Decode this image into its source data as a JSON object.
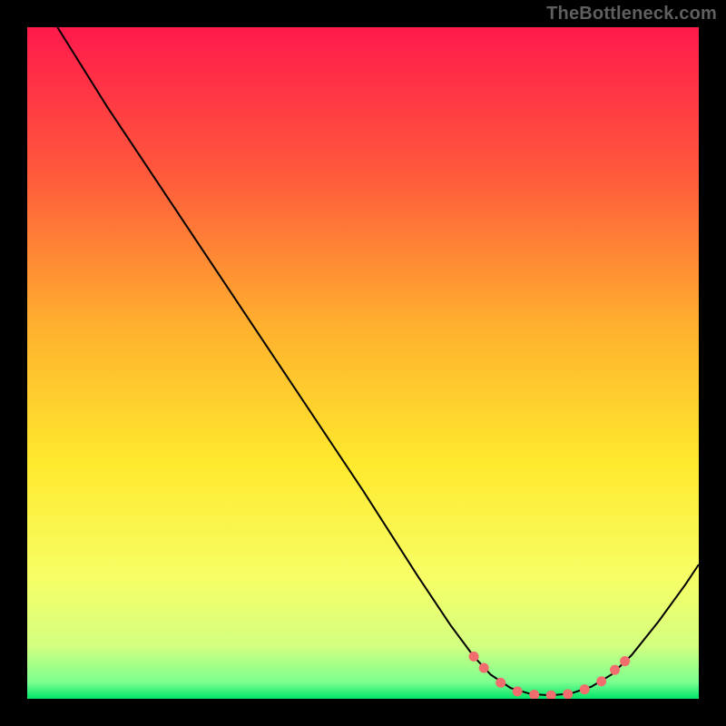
{
  "watermark": "TheBottleneck.com",
  "chart_data": {
    "type": "line",
    "title": "",
    "xlabel": "",
    "ylabel": "",
    "xlim": [
      0,
      100
    ],
    "ylim": [
      0,
      100
    ],
    "grid": false,
    "legend": false,
    "gradient_stops": [
      {
        "pos": 0.0,
        "color": "#ff1a4b"
      },
      {
        "pos": 0.22,
        "color": "#ff5a3c"
      },
      {
        "pos": 0.45,
        "color": "#ffb22e"
      },
      {
        "pos": 0.65,
        "color": "#ffe92e"
      },
      {
        "pos": 0.82,
        "color": "#f7ff66"
      },
      {
        "pos": 0.92,
        "color": "#d4ff80"
      },
      {
        "pos": 0.975,
        "color": "#7cff8f"
      },
      {
        "pos": 1.0,
        "color": "#00e56a"
      }
    ],
    "series": [
      {
        "name": "curve",
        "stroke": "#000000",
        "points": [
          {
            "x": 4.5,
            "y": 100.0
          },
          {
            "x": 7.0,
            "y": 96.0
          },
          {
            "x": 12.0,
            "y": 88.0
          },
          {
            "x": 20.0,
            "y": 76.0
          },
          {
            "x": 30.0,
            "y": 61.0
          },
          {
            "x": 40.0,
            "y": 46.0
          },
          {
            "x": 50.0,
            "y": 31.0
          },
          {
            "x": 58.0,
            "y": 18.5
          },
          {
            "x": 63.0,
            "y": 11.0
          },
          {
            "x": 66.5,
            "y": 6.3
          },
          {
            "x": 69.0,
            "y": 3.6
          },
          {
            "x": 72.0,
            "y": 1.6
          },
          {
            "x": 75.0,
            "y": 0.7
          },
          {
            "x": 78.0,
            "y": 0.5
          },
          {
            "x": 81.0,
            "y": 0.8
          },
          {
            "x": 84.0,
            "y": 1.8
          },
          {
            "x": 87.0,
            "y": 3.6
          },
          {
            "x": 90.0,
            "y": 6.5
          },
          {
            "x": 94.0,
            "y": 11.5
          },
          {
            "x": 98.0,
            "y": 17.0
          },
          {
            "x": 100.0,
            "y": 20.0
          }
        ]
      }
    ],
    "markers": {
      "color": "#f26d6d",
      "radius": 5.5,
      "points": [
        {
          "x": 66.5,
          "y": 6.3
        },
        {
          "x": 68.0,
          "y": 4.6
        },
        {
          "x": 70.5,
          "y": 2.4
        },
        {
          "x": 73.0,
          "y": 1.1
        },
        {
          "x": 75.5,
          "y": 0.6
        },
        {
          "x": 78.0,
          "y": 0.5
        },
        {
          "x": 80.5,
          "y": 0.7
        },
        {
          "x": 83.0,
          "y": 1.4
        },
        {
          "x": 85.5,
          "y": 2.6
        },
        {
          "x": 87.5,
          "y": 4.3
        },
        {
          "x": 89.0,
          "y": 5.6
        }
      ]
    }
  }
}
